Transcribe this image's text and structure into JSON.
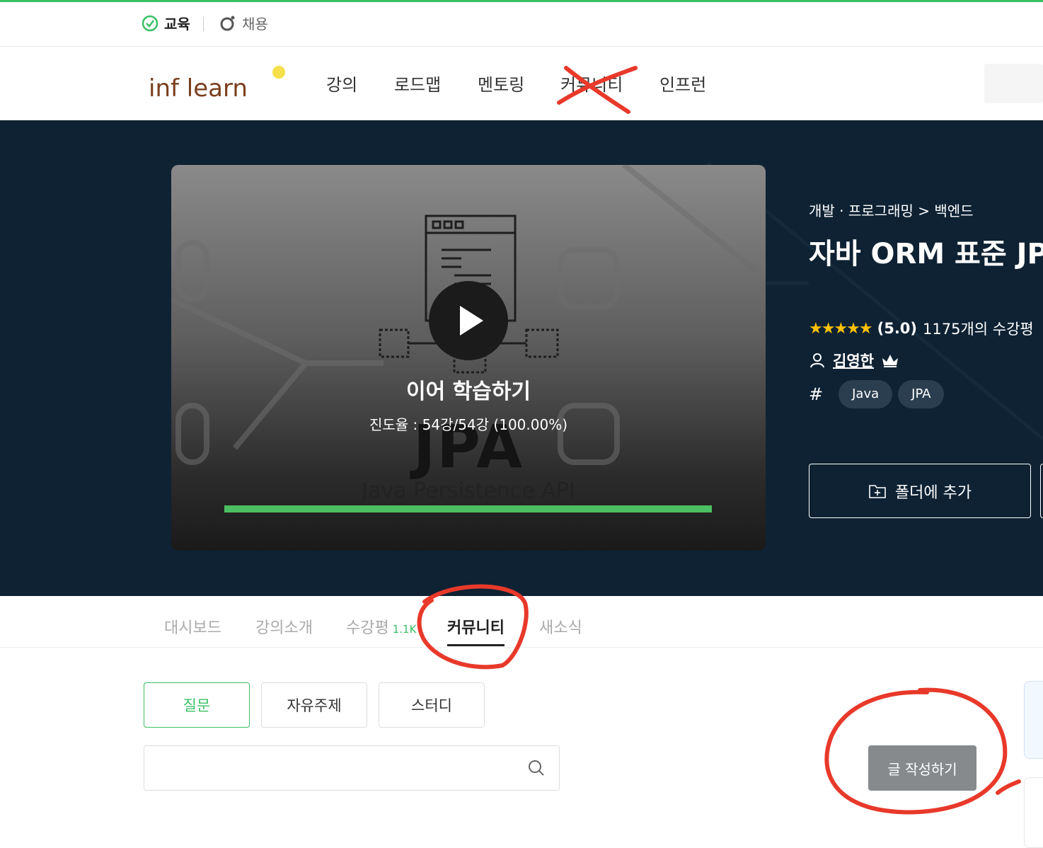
{
  "service_bar": {
    "education_label": "교육",
    "jobs_label": "채용"
  },
  "header": {
    "logo_text": "inf learn",
    "nav": [
      "강의",
      "로드맵",
      "멘토링",
      "커뮤니티",
      "인프런"
    ]
  },
  "player": {
    "resume_title": "이어 학습하기",
    "progress_text": "진도율 : 54강/54강 (100.00%)",
    "progress_fraction": 1.0,
    "thumbnail_title": "JPA",
    "thumbnail_subtitle": "Java Persistence API"
  },
  "course": {
    "category": "개발 · 프로그래밍 > 백엔드",
    "title": "자바 ORM 표준 JPA",
    "stars": "★★★★★",
    "rating": "(5.0)",
    "review_count": "1175개의 수강평",
    "instructor": "김영한",
    "tags": [
      "Java",
      "JPA"
    ],
    "folder_button": "폴더에 추가"
  },
  "tabs": {
    "items": [
      "대시보드",
      "강의소개",
      "수강평",
      "커뮤니티",
      "새소식"
    ],
    "review_count": "1.1K"
  },
  "community": {
    "chips": [
      "질문",
      "자유주제",
      "스터디"
    ],
    "write_button": "글 작성하기"
  },
  "colors": {
    "brand_green": "#3bc065",
    "hero_bg": "#0e2233",
    "annotation_red": "#e8392a"
  }
}
